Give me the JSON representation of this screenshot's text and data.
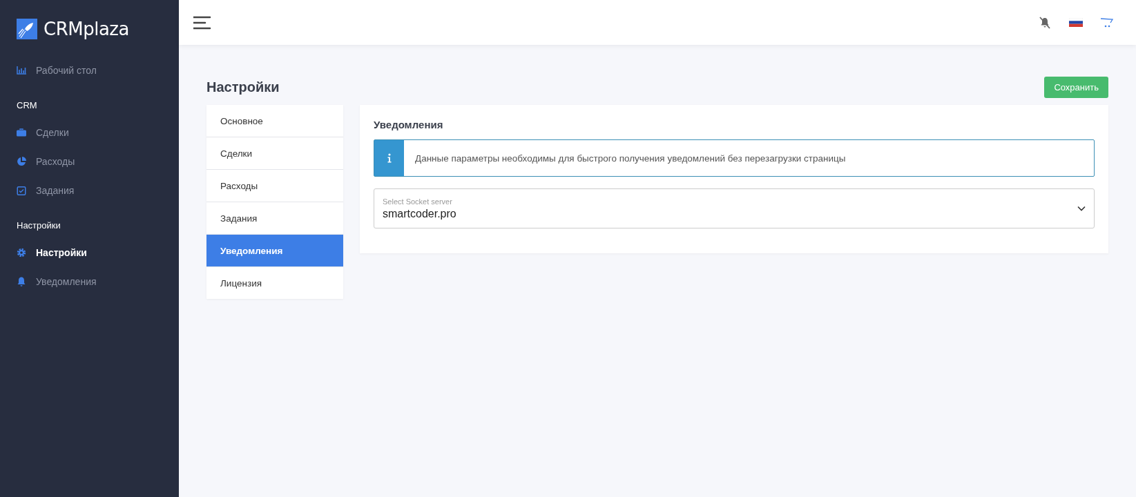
{
  "sidebar": {
    "logo": "CRMplaza",
    "sections": [
      {
        "items": [
          {
            "label": "Рабочий стол",
            "kind": "chart",
            "selected": false
          }
        ]
      },
      {
        "heading": "CRM",
        "items": [
          {
            "label": "Сделки",
            "kind": "briefcase",
            "selected": false
          },
          {
            "label": "Расходы",
            "kind": "pie",
            "selected": false
          },
          {
            "label": "Задания",
            "kind": "checkbox",
            "selected": false
          }
        ]
      },
      {
        "heading": "Настройки",
        "items": [
          {
            "label": "Настройки",
            "kind": "gear",
            "selected": true
          },
          {
            "label": "Уведомления",
            "kind": "bell",
            "selected": false
          }
        ]
      }
    ]
  },
  "page": {
    "title": "Настройки",
    "save_button": "Сохранить"
  },
  "settings_menu": [
    {
      "label": "Основное",
      "selected": false
    },
    {
      "label": "Сделки",
      "selected": false
    },
    {
      "label": "Расходы",
      "selected": false
    },
    {
      "label": "Задания",
      "selected": false
    },
    {
      "label": "Уведомления",
      "selected": true
    },
    {
      "label": "Лицензия",
      "selected": false
    }
  ],
  "panel": {
    "title": "Уведомления",
    "info": "Данные параметры необходимы для быстрого получения уведомлений без перезагрузки страницы",
    "select": {
      "label": "Select Socket server",
      "value": "smartcoder.pro"
    }
  }
}
